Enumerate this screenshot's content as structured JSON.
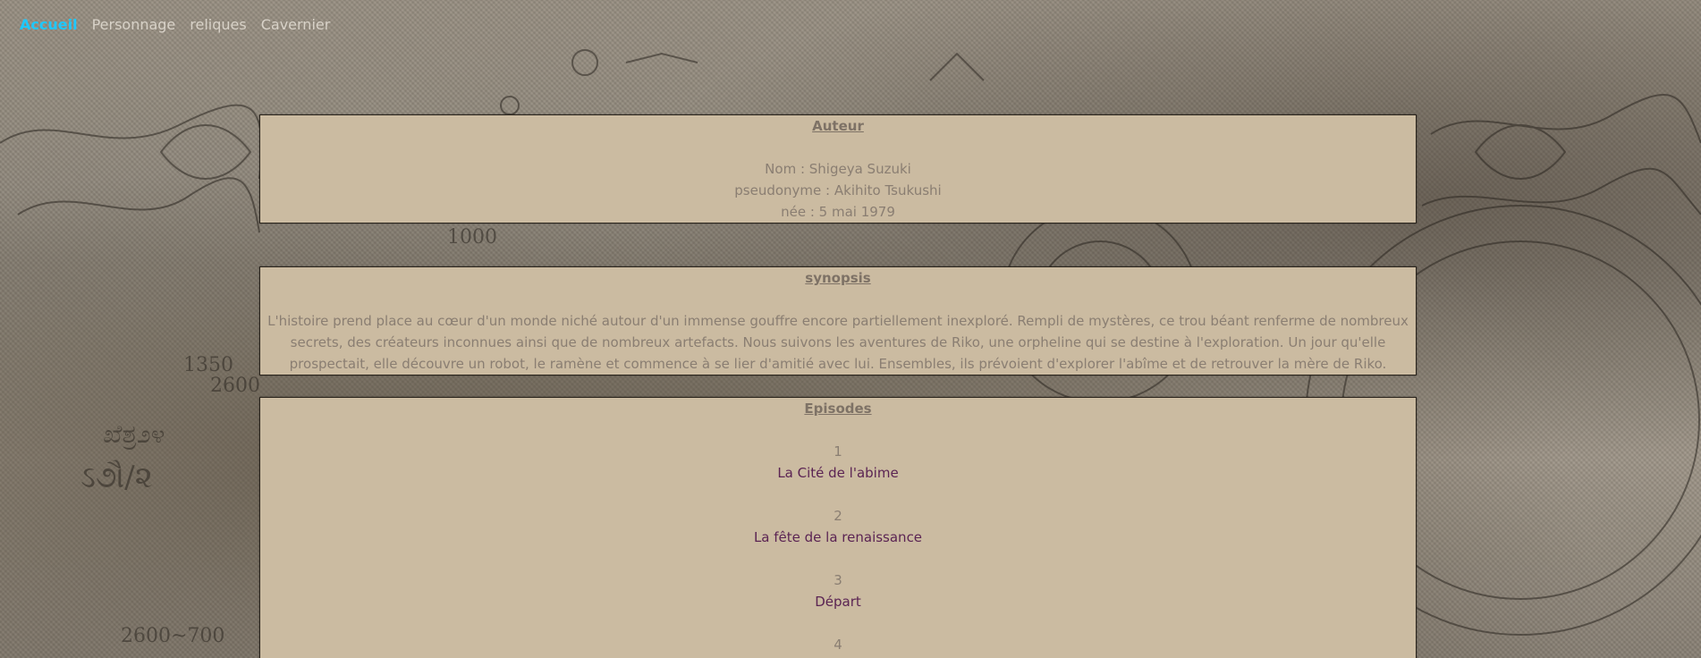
{
  "nav": {
    "items": [
      {
        "label": "Accueil",
        "active": true
      },
      {
        "label": "Personnage",
        "active": false
      },
      {
        "label": "reliques",
        "active": false
      },
      {
        "label": "Cavernier",
        "active": false
      }
    ]
  },
  "auteur": {
    "title": "Auteur",
    "nom": "Nom : Shigeya Suzuki",
    "pseudonyme": "pseudonyme : Akihito Tsukushi",
    "nee": "née : 5 mai 1979"
  },
  "synopsis": {
    "title": "synopsis",
    "text": "L'histoire prend place au cœur d'un monde niché autour d'un immense gouffre encore partiellement inexploré. Rempli de mystères, ce trou béant renferme de nombreux secrets, des créateurs inconnues ainsi que de nombreux artefacts. Nous suivons les aventures de Riko, une orpheline qui se destine à l'exploration. Un jour qu'elle prospectait, elle découvre un robot, le ramène et commence à se lier d'amitié avec lui. Ensembles, ils prévoient d'explorer l'abîme et de retrouver la mère de Riko."
  },
  "episodes": {
    "title": "Episodes",
    "items": [
      {
        "number": "1",
        "title": "La Cité de l'abime"
      },
      {
        "number": "2",
        "title": "La fête de la renaissance"
      },
      {
        "number": "3",
        "title": "Départ"
      },
      {
        "number": "4",
        "title": ""
      }
    ]
  },
  "colors": {
    "active_nav": "#1ec8ff",
    "panel_bg": "#cbbba1",
    "episode_link": "#5b2453"
  }
}
